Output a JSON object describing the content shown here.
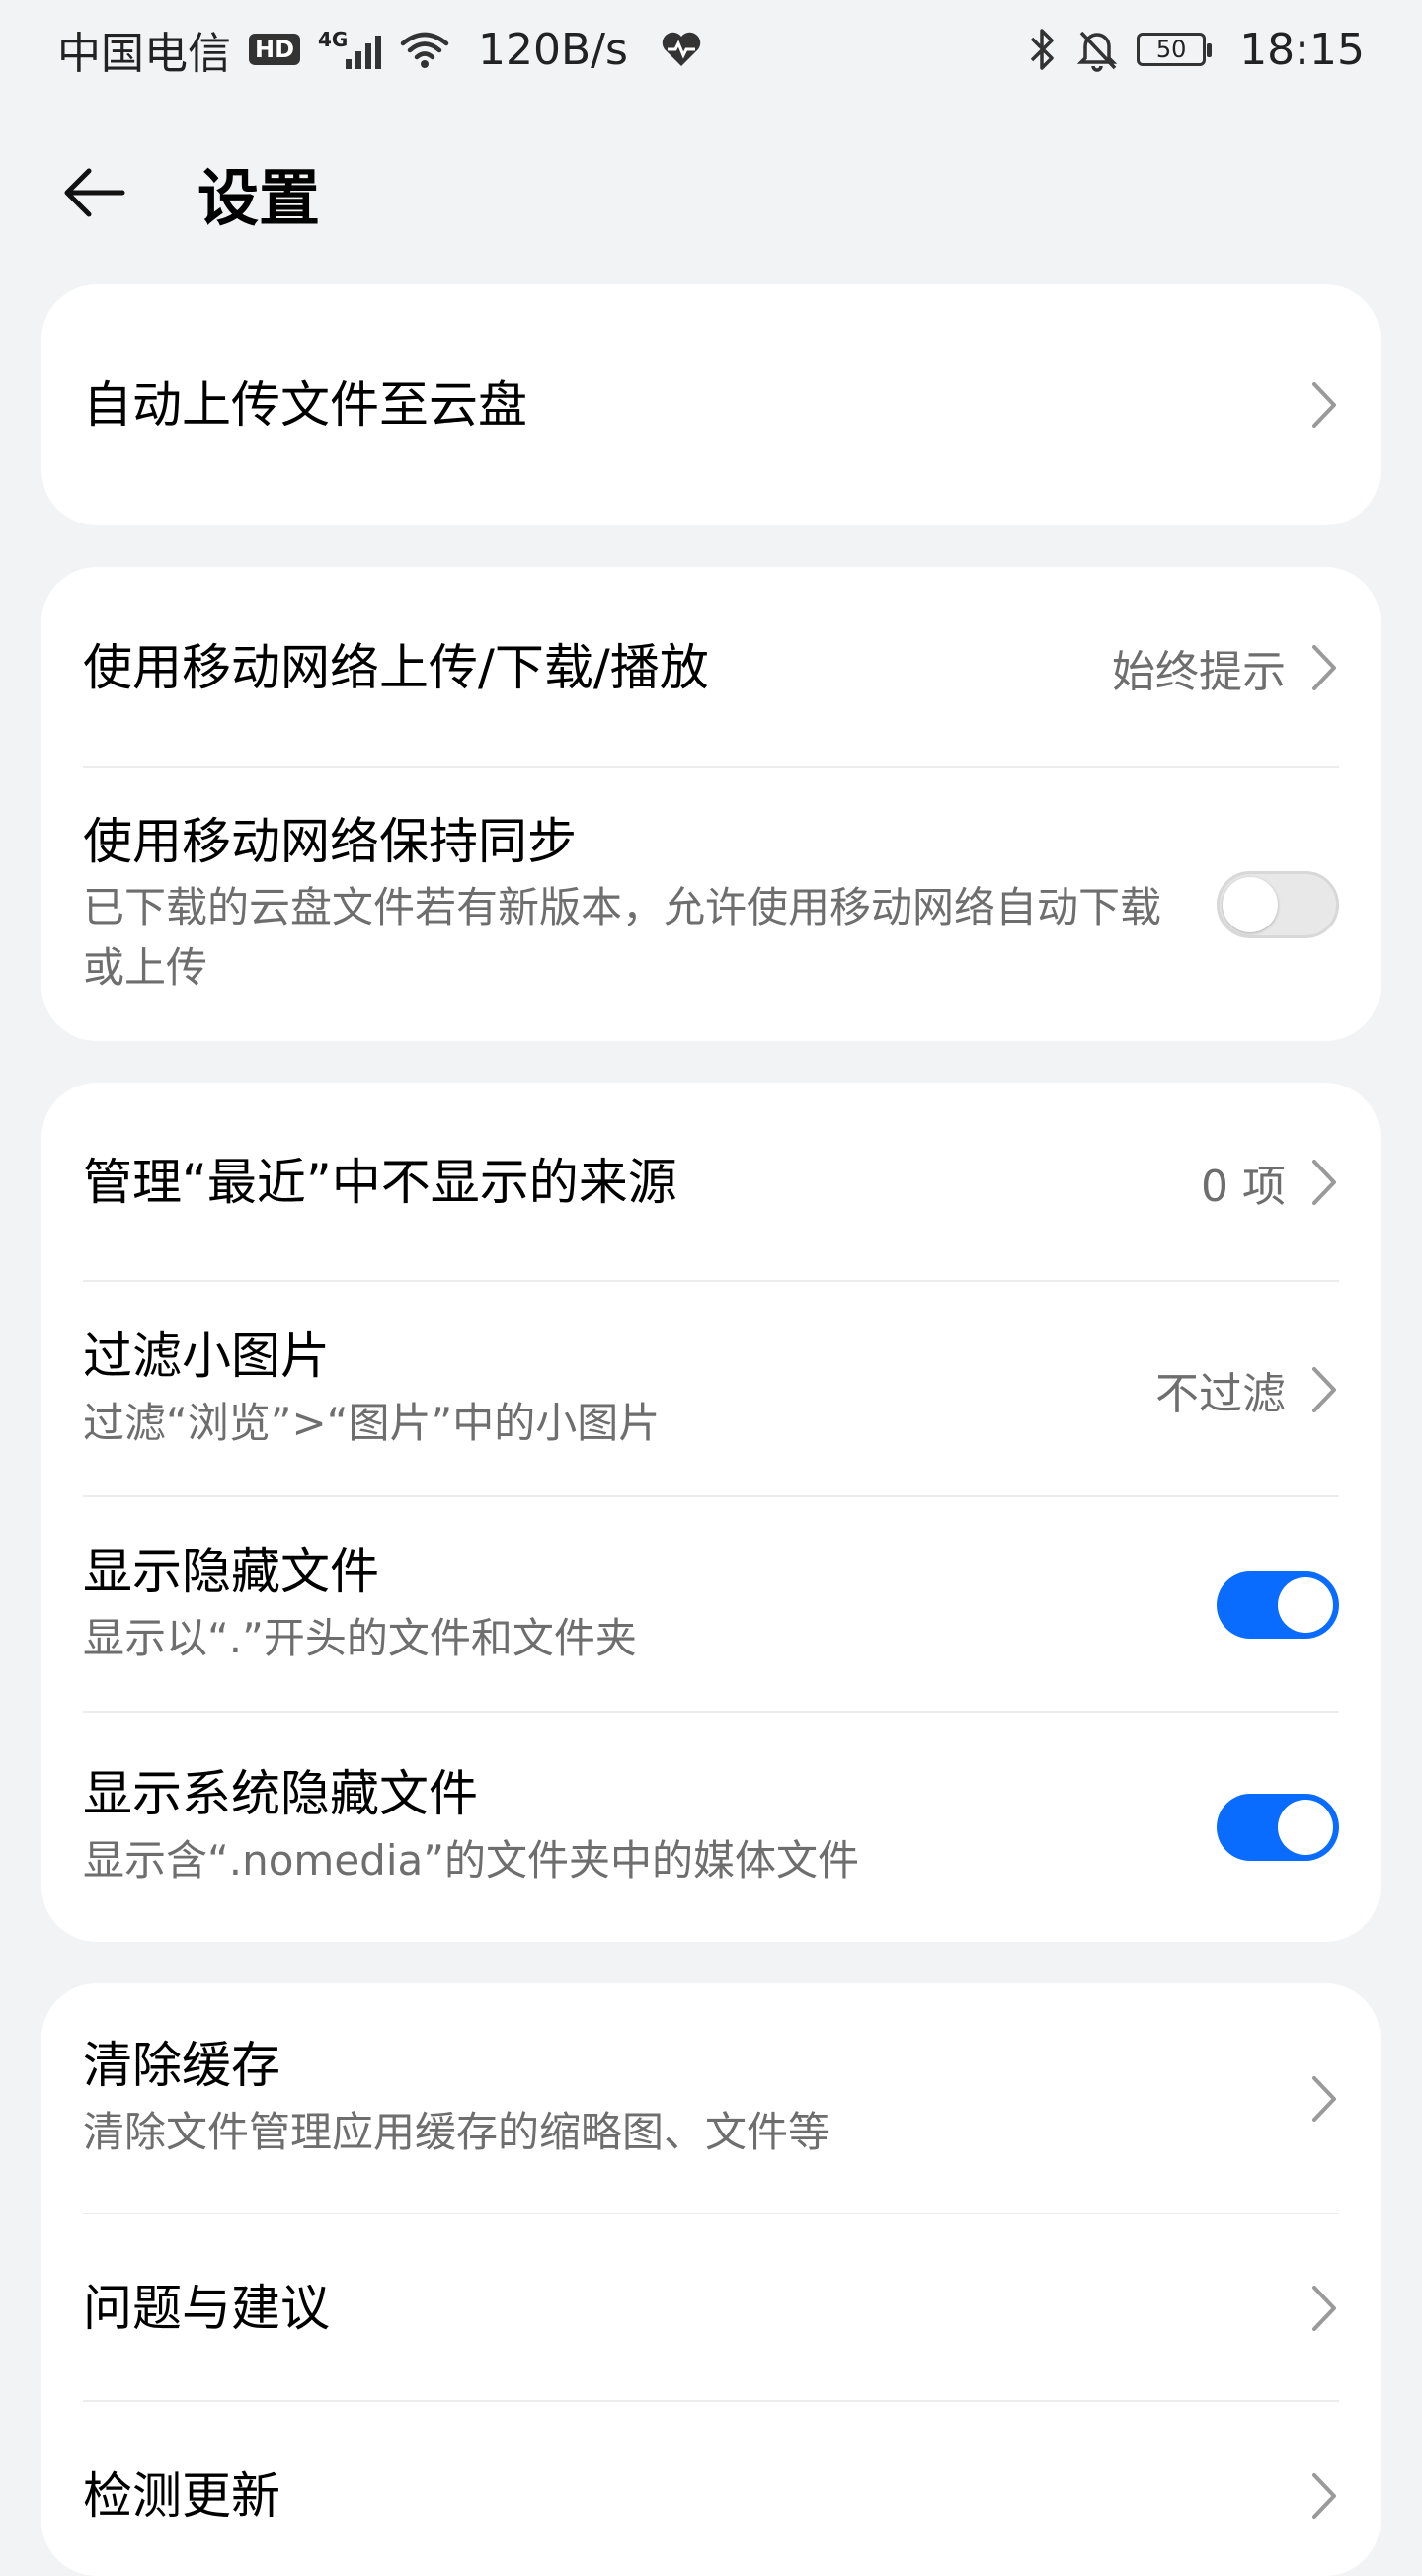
{
  "status_bar": {
    "carrier": "中国电信",
    "hd": "HD",
    "net_type": "4G",
    "speed": "120B/s",
    "battery": "50",
    "time": "18:15"
  },
  "header": {
    "title": "设置"
  },
  "cards": {
    "auto_upload": {
      "title": "自动上传文件至云盘"
    },
    "mobile_network": {
      "title": "使用移动网络上传/下载/播放",
      "value": "始终提示"
    },
    "mobile_sync": {
      "title": "使用移动网络保持同步",
      "sub": "已下载的云盘文件若有新版本，允许使用移动网络自动下载或上传",
      "enabled": false
    },
    "recent_sources": {
      "title": "管理“最近”中不显示的来源",
      "value": "0 项"
    },
    "filter_small": {
      "title": "过滤小图片",
      "sub": "过滤“浏览”>“图片”中的小图片",
      "value": "不过滤"
    },
    "show_hidden": {
      "title": "显示隐藏文件",
      "sub": "显示以“.”开头的文件和文件夹",
      "enabled": true
    },
    "show_system_hidden": {
      "title": "显示系统隐藏文件",
      "sub": "显示含“.nomedia”的文件夹中的媒体文件",
      "enabled": true
    },
    "clear_cache": {
      "title": "清除缓存",
      "sub": "清除文件管理应用缓存的缩略图、文件等"
    },
    "feedback": {
      "title": "问题与建议"
    },
    "check_update": {
      "title": "检测更新"
    }
  },
  "colors": {
    "background": "#f1f3f5",
    "card": "#ffffff",
    "toggle_on": "#0a6cff",
    "secondary_text": "#6e6e6e"
  }
}
